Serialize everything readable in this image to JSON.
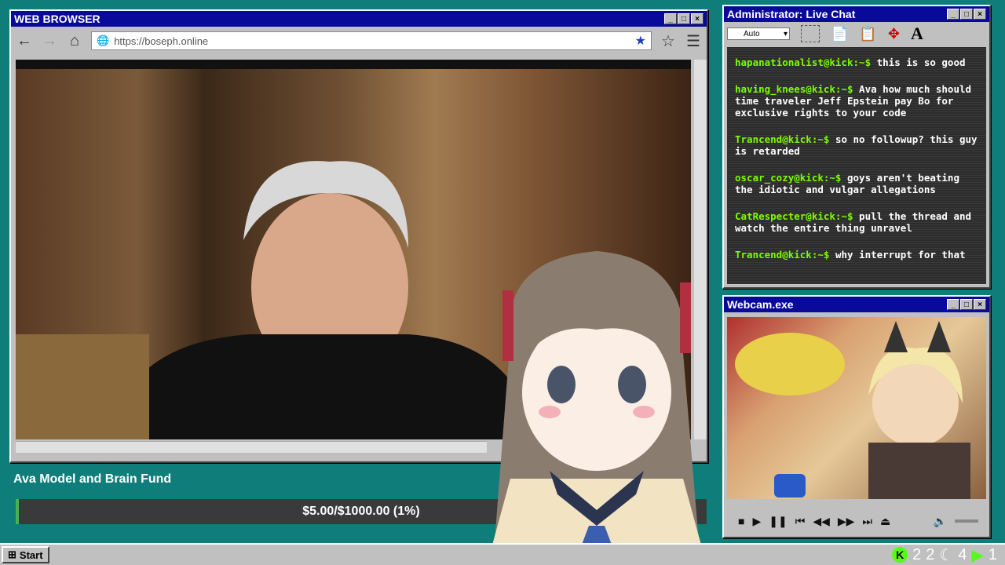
{
  "browser": {
    "title": "WEB BROWSER",
    "url": "https://boseph.online",
    "back_icon": "←",
    "forward_icon": "→",
    "home_icon": "⌂",
    "star_icon": "★",
    "bookmark_icon": "☆",
    "menu_icon": "☰"
  },
  "chat": {
    "title": "Administrator: Live Chat",
    "font_select": "Auto",
    "messages": [
      {
        "user": "hapanationalist@kick:~$",
        "text": "this is so good"
      },
      {
        "user": "having_knees@kick:~$",
        "text": "Ava how much should time traveler Jeff Epstein pay Bo for exclusive rights to your code"
      },
      {
        "user": "Trancend@kick:~$",
        "text": "so no followup? this guy is retarded"
      },
      {
        "user": "oscar_cozy@kick:~$",
        "text": "goys aren't beating the idiotic and vulgar allegations"
      },
      {
        "user": "CatRespecter@kick:~$",
        "text": "pull the thread and watch the entire thing unravel"
      },
      {
        "user": "Trancend@kick:~$",
        "text": "why interrupt for that"
      }
    ]
  },
  "webcam": {
    "title": "Webcam.exe"
  },
  "fund": {
    "title": "Ava Model and Brain Fund",
    "progress_text": "$5.00/$1000.00 (1%)",
    "progress_fraction": 0.005
  },
  "taskbar": {
    "start_label": "Start",
    "tray": [
      "2",
      "2",
      "4",
      "1"
    ]
  },
  "colors": {
    "desktop": "#0f7d7a",
    "titlebar": "#0a0a9a",
    "chat_user": "#7CFC00"
  }
}
